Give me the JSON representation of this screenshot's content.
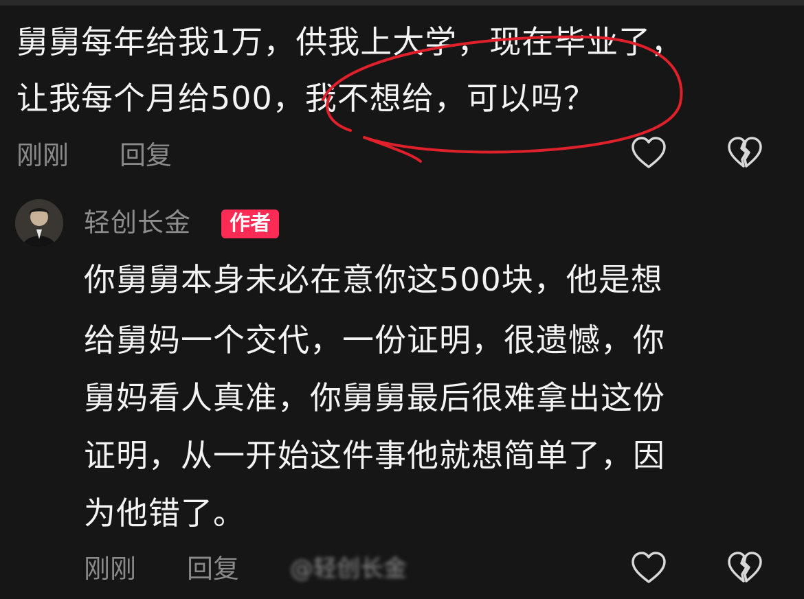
{
  "comment": {
    "lines": [
      "舅舅每年给我1万，供我上大学，现在毕业了，",
      "让我每个月给500，我不想给，可以吗？"
    ],
    "time": "刚刚",
    "reply_label": "回复",
    "like_icon": "heart-outline-icon",
    "dislike_icon": "broken-heart-icon"
  },
  "reply": {
    "author_name": "轻创长金",
    "author_badge": "作者",
    "lines": [
      "你舅舅本身未必在意你这500块，他是想",
      "给舅妈一个交代，一份证明，很遗憾，你",
      "舅妈看人真准，你舅舅最后很难拿出这份",
      "证明，从一开始这件事他就想简单了，因",
      "为他错了。"
    ],
    "time": "刚刚",
    "reply_label": "回复",
    "watermark": "@轻创长金",
    "like_icon": "heart-outline-icon",
    "dislike_icon": "broken-heart-icon"
  },
  "colors": {
    "background": "#161616",
    "text": "#f4f4f4",
    "muted": "#8a8a8a",
    "badge": "#fe2c55",
    "annotation": "#e0202a"
  }
}
